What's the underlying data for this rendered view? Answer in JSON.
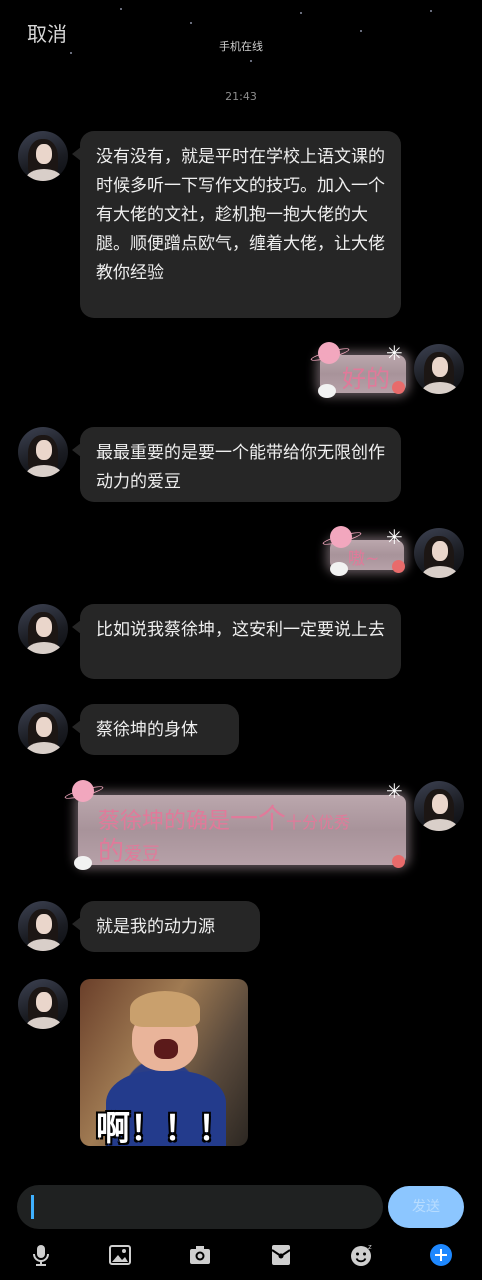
{
  "header": {
    "cancel_label": "取消",
    "subtitle": "手机在线"
  },
  "timestamp": "21:43",
  "messages": [
    {
      "side": "left",
      "type": "text",
      "text": "没有没有，就是平时在学校上语文课的时候多听一下写作文的技巧。加入一个有大佬的文社，趁机抱一抱大佬的大腿。顺便蹭点欧气，缠着大佬，让大佬教你经验"
    },
    {
      "side": "right",
      "type": "sticker",
      "text": "好的"
    },
    {
      "side": "left",
      "type": "text",
      "text": "最最重要的是要一个能带给你无限创作动力的爱豆"
    },
    {
      "side": "right",
      "type": "sticker",
      "text": "嗷~"
    },
    {
      "side": "left",
      "type": "text",
      "text": "比如说我蔡徐坤，这安利一定要说上去"
    },
    {
      "side": "left",
      "type": "text",
      "text": "蔡徐坤的身体"
    },
    {
      "side": "right",
      "type": "sticker",
      "text_parts": [
        "蔡徐坤的确是",
        "一个",
        "十分优秀",
        "的",
        "爱豆"
      ]
    },
    {
      "side": "left",
      "type": "text",
      "text": "就是我的动力源"
    },
    {
      "side": "left",
      "type": "image",
      "caption": "啊！！！"
    }
  ],
  "composer": {
    "send_label": "发送"
  },
  "toolbar": {
    "items": [
      "microphone-icon",
      "image-icon",
      "camera-icon",
      "red-packet-icon",
      "emoji-icon",
      "plus-icon"
    ]
  },
  "colors": {
    "background": "#000000",
    "bubble": "#262626",
    "accent": "#1e88ff",
    "send": "#8cc6ff",
    "sticker_text": "#e07a9a"
  }
}
